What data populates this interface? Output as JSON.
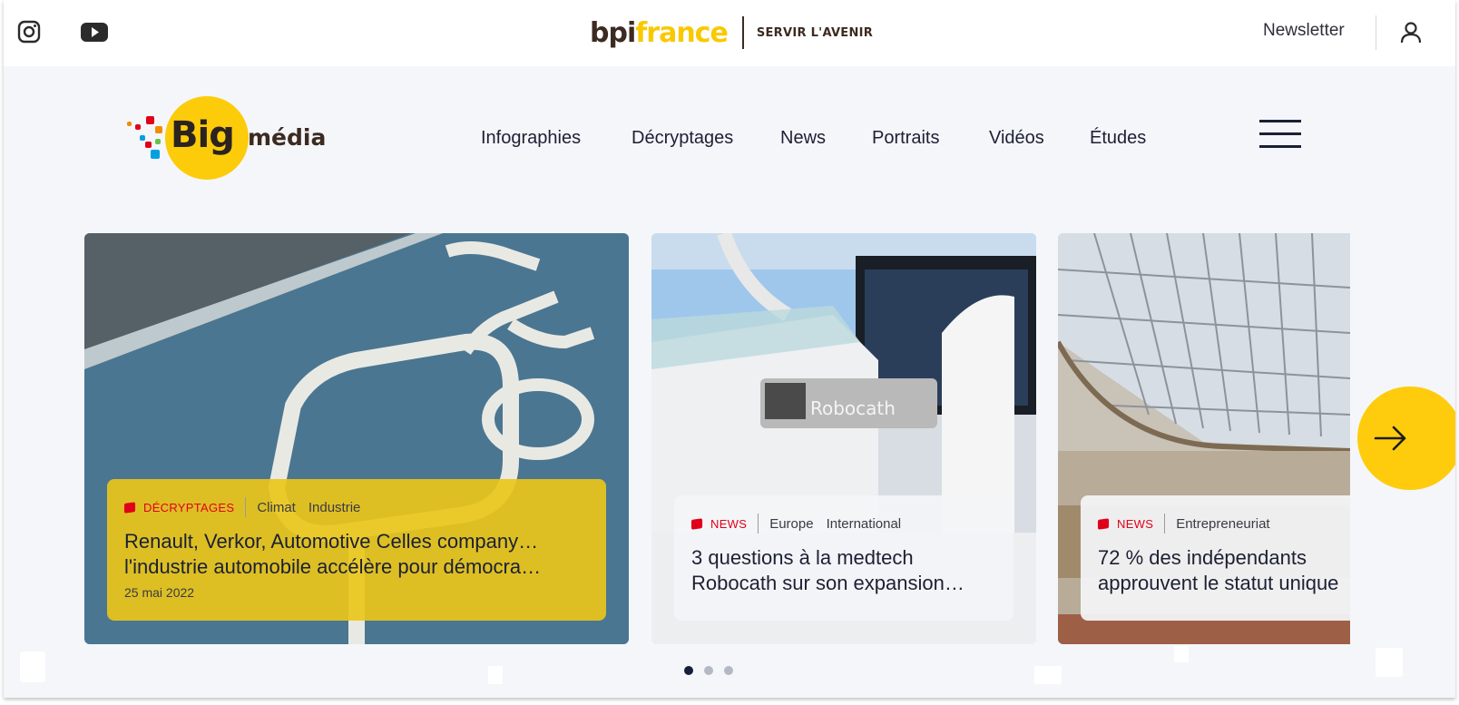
{
  "header": {
    "brand_bpi": "bpi",
    "brand_france": "france",
    "brand_tagline": "SERVIR L'AVENIR",
    "newsletter_label": "Newsletter"
  },
  "logo": {
    "big": "Big",
    "media": "média"
  },
  "nav": {
    "items": [
      {
        "label": "Infographies"
      },
      {
        "label": "Décryptages"
      },
      {
        "label": "News"
      },
      {
        "label": "Portraits"
      },
      {
        "label": "Vidéos"
      },
      {
        "label": "Études"
      }
    ]
  },
  "cards": [
    {
      "category": "DÉCRYPTAGES",
      "tags": [
        "Climat",
        "Industrie"
      ],
      "title_line1": "Renault, Verkor, Automotive Celles company…",
      "title_line2": "l'industrie automobile accélère pour démocra…",
      "date": "25 mai 2022"
    },
    {
      "category": "NEWS",
      "tags": [
        "Europe",
        "International"
      ],
      "title_line1": "3 questions à la medtech",
      "title_line2": "Robocath sur son expansion…",
      "device_label": "Robocath"
    },
    {
      "category": "NEWS",
      "tags": [
        "Entrepreneuriat"
      ],
      "title_line1": "72 % des indépendants",
      "title_line2": "approuvent le statut unique"
    }
  ],
  "carousel": {
    "page_count": 3,
    "active_page": 1
  },
  "colors": {
    "brand_yellow": "#ffcc0d",
    "brand_brown": "#3d2a20",
    "category_red": "#e1001a",
    "nav_text": "#1c2033"
  },
  "icons": [
    "instagram-icon",
    "youtube-icon",
    "user-icon",
    "menu-icon",
    "arrow-right-icon"
  ]
}
